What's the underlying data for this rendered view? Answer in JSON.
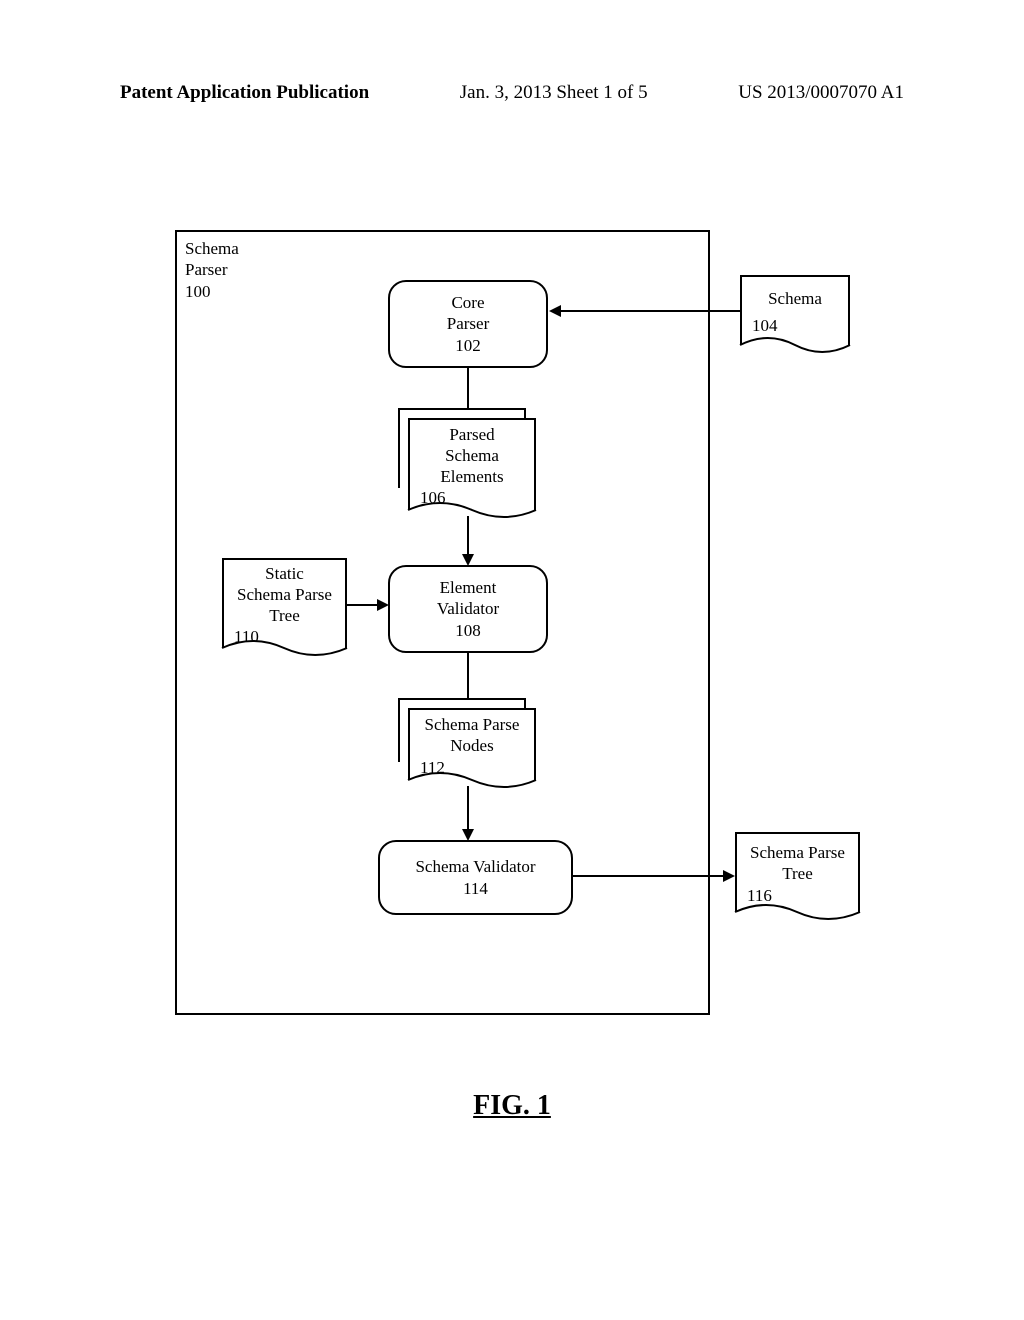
{
  "header": {
    "left": "Patent Application Publication",
    "center": "Jan. 3, 2013  Sheet 1 of 5",
    "right": "US 2013/0007070 A1"
  },
  "container": {
    "title_line1": "Schema",
    "title_line2": "Parser",
    "title_line3": "100"
  },
  "boxes": {
    "core_parser": {
      "l1": "Core",
      "l2": "Parser",
      "l3": "102"
    },
    "schema_in": {
      "l1": "Schema",
      "l2": "104"
    },
    "parsed_elements": {
      "l1": "Parsed",
      "l2": "Schema",
      "l3": "Elements",
      "l4": "106"
    },
    "element_validator": {
      "l1": "Element",
      "l2": "Validator",
      "l3": "108"
    },
    "static_tree": {
      "l1": "Static",
      "l2": "Schema Parse",
      "l3": "Tree",
      "l4": "110"
    },
    "parse_nodes": {
      "l1": "Schema Parse",
      "l2": "Nodes",
      "l3": "112"
    },
    "schema_validator": {
      "l1": "Schema Validator",
      "l2": "114"
    },
    "parse_tree_out": {
      "l1": "Schema Parse",
      "l2": "Tree",
      "l3": "116"
    }
  },
  "figure_label": "FIG. 1"
}
